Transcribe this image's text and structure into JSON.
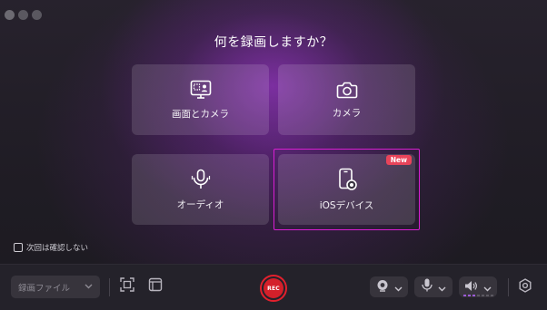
{
  "title": "何を録画しますか？",
  "cards": {
    "screen_camera": {
      "label": "画面とカメラ",
      "icon": "screen-camera-icon"
    },
    "camera": {
      "label": "カメラ",
      "icon": "camera-icon"
    },
    "audio": {
      "label": "オーディオ",
      "icon": "microphone-icon"
    },
    "ios": {
      "label": "iOSデバイス",
      "icon": "ios-device-icon",
      "badge": "New"
    }
  },
  "dont_ask": {
    "label": "次回は確認しない",
    "checked": false
  },
  "bottombar": {
    "file_dropdown": "録画ファイル",
    "rec_label": "REC"
  },
  "colors": {
    "accent_highlight": "#d81ed2",
    "rec_red": "#d4202a",
    "badge_red": "#e8445a"
  }
}
